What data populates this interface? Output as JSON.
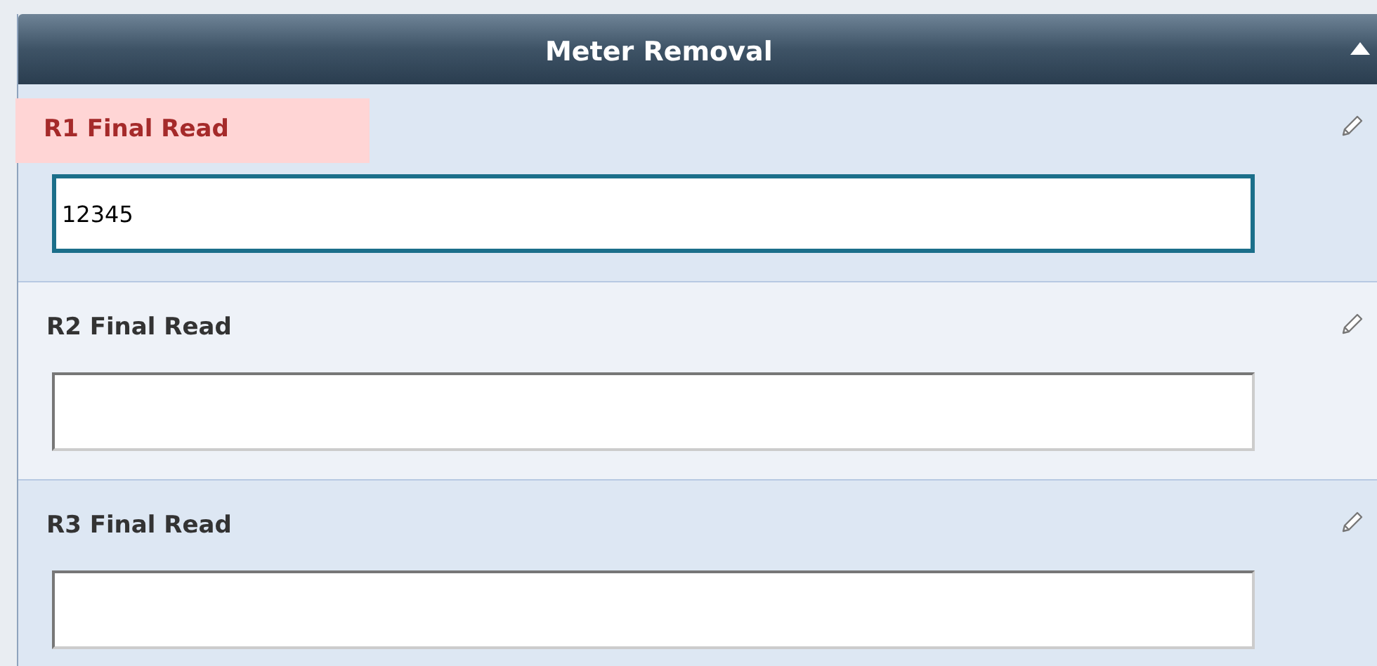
{
  "panel": {
    "title": "Meter Removal",
    "expanded": true
  },
  "fields": [
    {
      "label": "R1 Final Read",
      "value": "12345",
      "invalid": true,
      "focused": true
    },
    {
      "label": "R2 Final Read",
      "invalid": false,
      "focused": false
    },
    {
      "label": "R3 Final Read",
      "invalid": false,
      "focused": false
    }
  ]
}
